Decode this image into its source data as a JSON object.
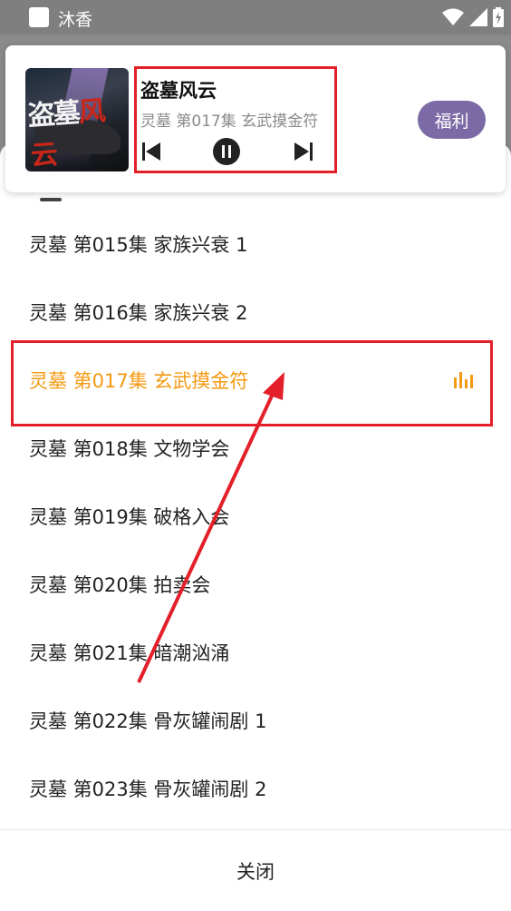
{
  "status_bar": {
    "app_name": "沐香"
  },
  "player": {
    "cover_title_1": "盗墓",
    "cover_title_2": "风云",
    "title": "盗墓风云",
    "subtitle": "灵墓 第017集 玄武摸金符",
    "welfare_label": "福利",
    "prev_icon": "skip-previous-icon",
    "play_pause_icon": "pause-icon",
    "next_icon": "skip-next-icon"
  },
  "episodes": [
    {
      "label": "灵墓 第015集 家族兴衰 1",
      "active": false
    },
    {
      "label": "灵墓 第016集 家族兴衰 2",
      "active": false
    },
    {
      "label": "灵墓 第017集 玄武摸金符",
      "active": true
    },
    {
      "label": "灵墓 第018集 文物学会",
      "active": false
    },
    {
      "label": "灵墓 第019集 破格入会",
      "active": false
    },
    {
      "label": "灵墓 第020集 拍卖会",
      "active": false
    },
    {
      "label": "灵墓 第021集 暗潮汹涌",
      "active": false
    },
    {
      "label": "灵墓 第022集 骨灰罐闹剧 1",
      "active": false
    },
    {
      "label": "灵墓 第023集 骨灰罐闹剧 2",
      "active": false
    }
  ],
  "close_label": "关闭",
  "colors": {
    "accent": "#f39a12",
    "welfare": "#7c6aa6",
    "annotation_red": "#e3202a"
  }
}
